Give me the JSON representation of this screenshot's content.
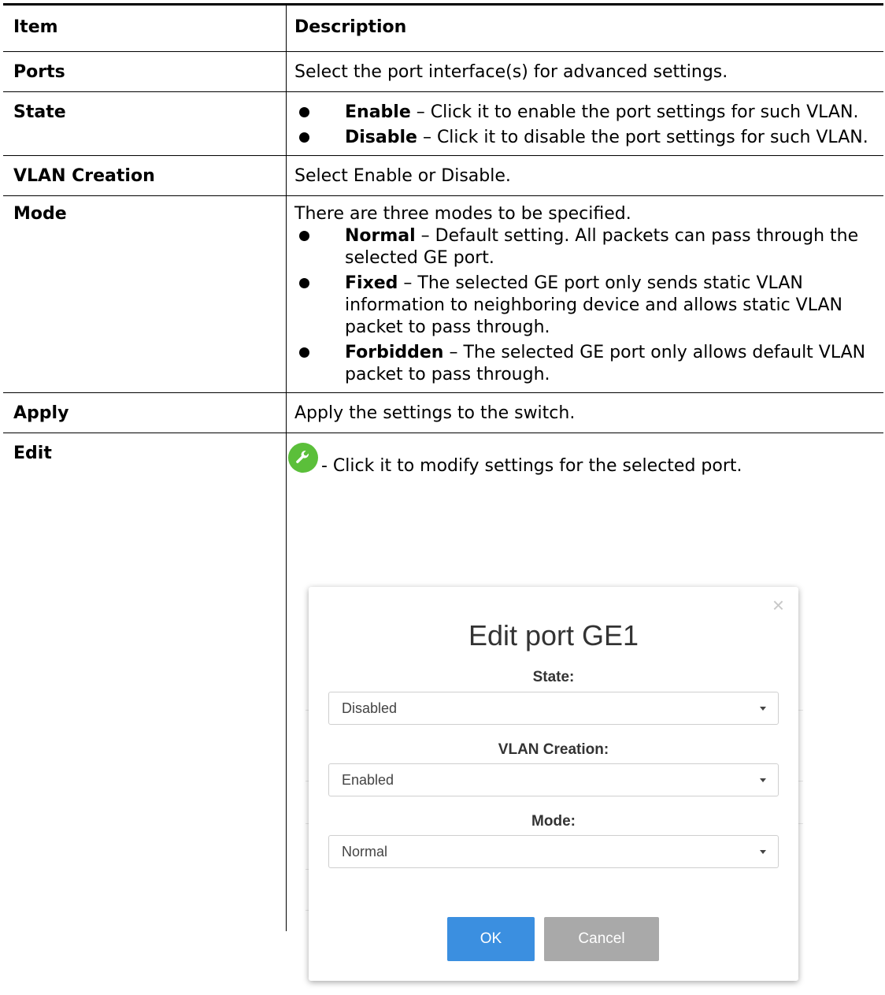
{
  "table": {
    "header": {
      "item": "Item",
      "description": "Description"
    },
    "rows": {
      "ports": {
        "item": "Ports",
        "desc": "Select the port interface(s) for advanced settings."
      },
      "state": {
        "item": "State",
        "bullets": [
          {
            "term": "Enable",
            "text": " – Click it to enable the port settings for such VLAN."
          },
          {
            "term": "Disable",
            "text": " – Click it to disable the port settings for such VLAN."
          }
        ]
      },
      "vlan_creation": {
        "item": "VLAN Creation",
        "desc": "Select Enable or Disable."
      },
      "mode": {
        "item": "Mode",
        "intro": "There are three modes to be specified.",
        "bullets": [
          {
            "term": "Normal",
            "text": " – Default setting. All packets can pass through the selected GE port."
          },
          {
            "term": "Fixed",
            "text": " – The selected GE port only sends static VLAN information to neighboring device and allows static VLAN packet to pass through."
          },
          {
            "term": "Forbidden",
            "text": " – The selected GE port only allows default VLAN packet to pass through."
          }
        ]
      },
      "apply": {
        "item": "Apply",
        "desc": "Apply the settings to the switch."
      },
      "edit": {
        "item": "Edit",
        "desc": "- Click it to modify settings for the selected port."
      }
    }
  },
  "icons": {
    "edit_icon": "wrench-icon",
    "close_icon": "close-icon",
    "caret_icon": "caret-down-icon"
  },
  "colors": {
    "wrench_bg": "#5bbf3a",
    "ok_bg": "#3b8fe0",
    "cancel_bg": "#a9a9a9"
  },
  "modal": {
    "title": "Edit port GE1",
    "close_glyph": "×",
    "state_label": "State:",
    "state_value": "Disabled",
    "vlan_label": "VLAN Creation:",
    "vlan_value": "Enabled",
    "mode_label": "Mode:",
    "mode_value": "Normal",
    "ok_label": "OK",
    "cancel_label": "Cancel"
  }
}
